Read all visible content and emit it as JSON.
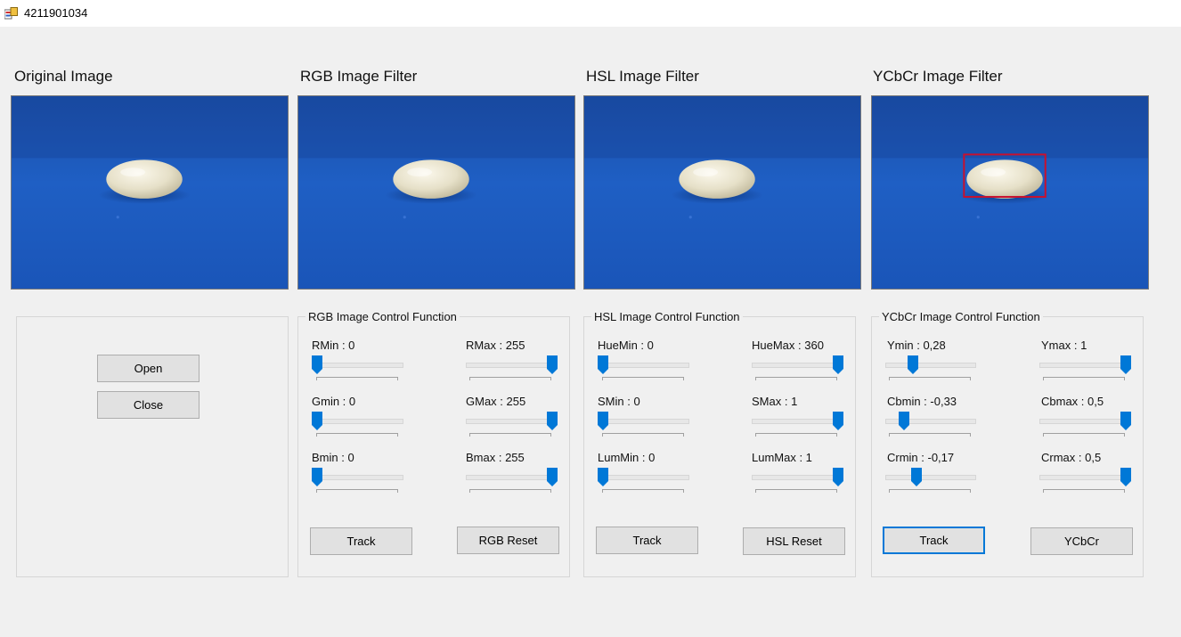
{
  "window": {
    "title": "4211901034"
  },
  "columns": [
    {
      "title": "Original Image",
      "show_box": false
    },
    {
      "title": "RGB Image Filter",
      "show_box": false
    },
    {
      "title": "HSL Image Filter",
      "show_box": false
    },
    {
      "title": "YCbCr Image Filter",
      "show_box": true
    }
  ],
  "file_buttons": {
    "open": "Open",
    "close": "Close"
  },
  "rgb_group": {
    "label": "RGB Image Control Function",
    "sliders": [
      {
        "label": "RMin : 0",
        "fraction": 0
      },
      {
        "label": "RMax : 255",
        "fraction": 1
      },
      {
        "label": "Gmin : 0",
        "fraction": 0
      },
      {
        "label": "GMax : 255",
        "fraction": 1
      },
      {
        "label": "Bmin : 0",
        "fraction": 0
      },
      {
        "label": "Bmax : 255",
        "fraction": 1
      }
    ],
    "track_label": "Track",
    "reset_label": "RGB Reset"
  },
  "hsl_group": {
    "label": "HSL Image Control Function",
    "sliders": [
      {
        "label": "HueMin : 0",
        "fraction": 0
      },
      {
        "label": "HueMax : 360",
        "fraction": 1
      },
      {
        "label": "SMin : 0",
        "fraction": 0
      },
      {
        "label": "SMax : 1",
        "fraction": 1
      },
      {
        "label": "LumMin : 0",
        "fraction": 0
      },
      {
        "label": "LumMax : 1",
        "fraction": 1
      }
    ],
    "track_label": "Track",
    "reset_label": "HSL Reset"
  },
  "ycbcr_group": {
    "label": "YCbCr Image Control Function",
    "sliders": [
      {
        "label": "Ymin : 0,28",
        "fraction": 0.28
      },
      {
        "label": "Ymax : 1",
        "fraction": 1
      },
      {
        "label": "Cbmin : -0,33",
        "fraction": 0.17
      },
      {
        "label": "Cbmax : 0,5",
        "fraction": 1
      },
      {
        "label": "Crmin : -0,17",
        "fraction": 0.33
      },
      {
        "label": "Crmax : 0,5",
        "fraction": 1
      }
    ],
    "track_label": "Track",
    "ycbcr_label": "YCbCr"
  },
  "colors": {
    "accent": "#0078d7",
    "detection_box": "#c8102e",
    "background": "#f0f0f0",
    "button_face": "#e1e1e1"
  }
}
